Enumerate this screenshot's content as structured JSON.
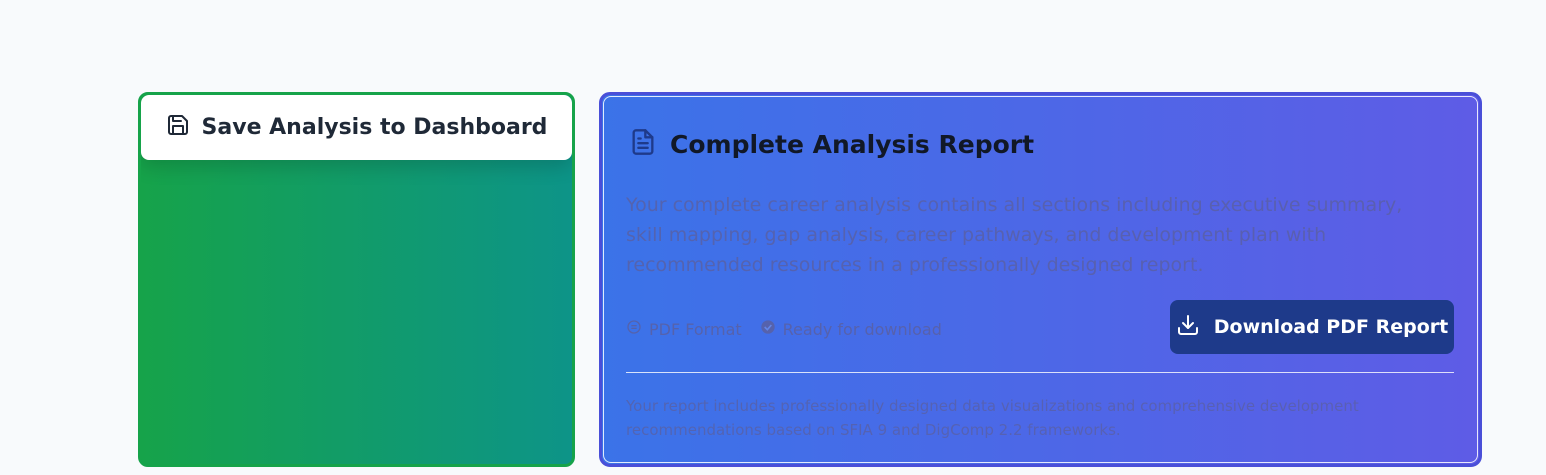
{
  "save_card": {
    "button_label": "Save Analysis to Dashboard",
    "icon": "save-icon",
    "gradient_colors": [
      "#16a34a",
      "#0d9488"
    ]
  },
  "report_card": {
    "title": "Complete Analysis Report",
    "title_icon": "document-icon",
    "description": "Your complete career analysis contains all sections including executive summary, skill mapping, gap analysis, career pathways, and development plan with recommended resources in a professionally designed report.",
    "meta": [
      {
        "icon": "file-format-icon",
        "label": "PDF Format"
      },
      {
        "icon": "check-circle-icon",
        "label": "Ready for download"
      }
    ],
    "download_button": {
      "label": "Download PDF Report",
      "icon": "download-icon"
    },
    "footer_note": "Your report includes professionally designed data visualizations and comprehensive development recommendations based on SFIA 9 and DigComp 2.2 frameworks.",
    "gradient_colors": [
      "#3b73e8",
      "#5e5ce6"
    ]
  }
}
